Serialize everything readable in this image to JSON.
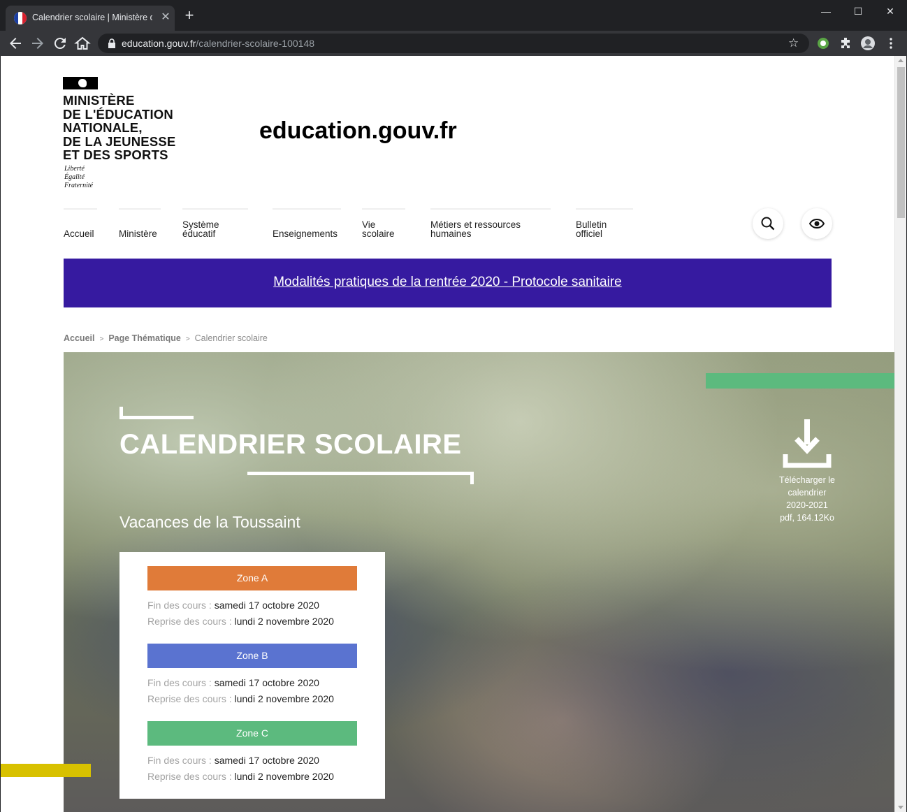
{
  "browser": {
    "tab_title": "Calendrier scolaire | Ministère de l'Éducation",
    "tab_close": "✕",
    "new_tab": "+",
    "window_controls": {
      "minimize": "—",
      "maximize": "☐",
      "close": "✕"
    },
    "url_domain": "education.gouv.fr",
    "url_path": "/calendrier-scolaire-100148",
    "bookmark_star": "☆",
    "icons": [
      "back-icon",
      "forward-icon",
      "reload-icon",
      "home-icon",
      "lock-icon",
      "star-icon",
      "extension-icon",
      "puzzle-icon",
      "profile-avatar",
      "menu-kebab-icon"
    ]
  },
  "header": {
    "ministry_lines": [
      "MINISTÈRE",
      "DE L'ÉDUCATION",
      "NATIONALE,",
      "DE LA JEUNESSE",
      "ET DES SPORTS"
    ],
    "devise": [
      "Liberté",
      "Égalité",
      "Fraternité"
    ],
    "site_name": "education.gouv.fr"
  },
  "nav": {
    "items": [
      {
        "label": "Accueil"
      },
      {
        "label": "Ministère"
      },
      {
        "label": "Système\néducatif"
      },
      {
        "label": "Enseignements"
      },
      {
        "label": "Vie\nscolaire"
      },
      {
        "label": "Métiers et ressources\nhumaines"
      },
      {
        "label": "Bulletin\nofficiel"
      }
    ],
    "buttons": [
      "search-icon",
      "eye-accessibility-icon"
    ]
  },
  "banner": {
    "text": "Modalités pratiques de la rentrée 2020 - Protocole sanitaire",
    "color": "#361aa0"
  },
  "breadcrumb": {
    "items": [
      "Accueil",
      "Page Thématique",
      "Calendrier scolaire"
    ],
    "separator": ">"
  },
  "hero": {
    "title": "CALENDRIER SCOLAIRE",
    "subtitle": "Vacances de la Toussaint",
    "download_text": "Télécharger le calendrier 2020-2021 pdf, 164.12Ko",
    "accent_colors": {
      "green": "#5cba7e",
      "yellow": "#d8c100"
    }
  },
  "zones": [
    {
      "name": "Zone A",
      "color": "#e07b39",
      "fin_label": "Fin des cours :",
      "fin_value": "samedi 17 octobre 2020",
      "reprise_label": "Reprise des cours :",
      "reprise_value": "lundi 2 novembre 2020"
    },
    {
      "name": "Zone B",
      "color": "#5a73d0",
      "fin_label": "Fin des cours :",
      "fin_value": "samedi 17 octobre 2020",
      "reprise_label": "Reprise des cours :",
      "reprise_value": "lundi 2 novembre 2020"
    },
    {
      "name": "Zone C",
      "color": "#5cba7e",
      "fin_label": "Fin des cours :",
      "fin_value": "samedi 17 octobre 2020",
      "reprise_label": "Reprise des cours :",
      "reprise_value": "lundi 2 novembre 2020"
    }
  ]
}
